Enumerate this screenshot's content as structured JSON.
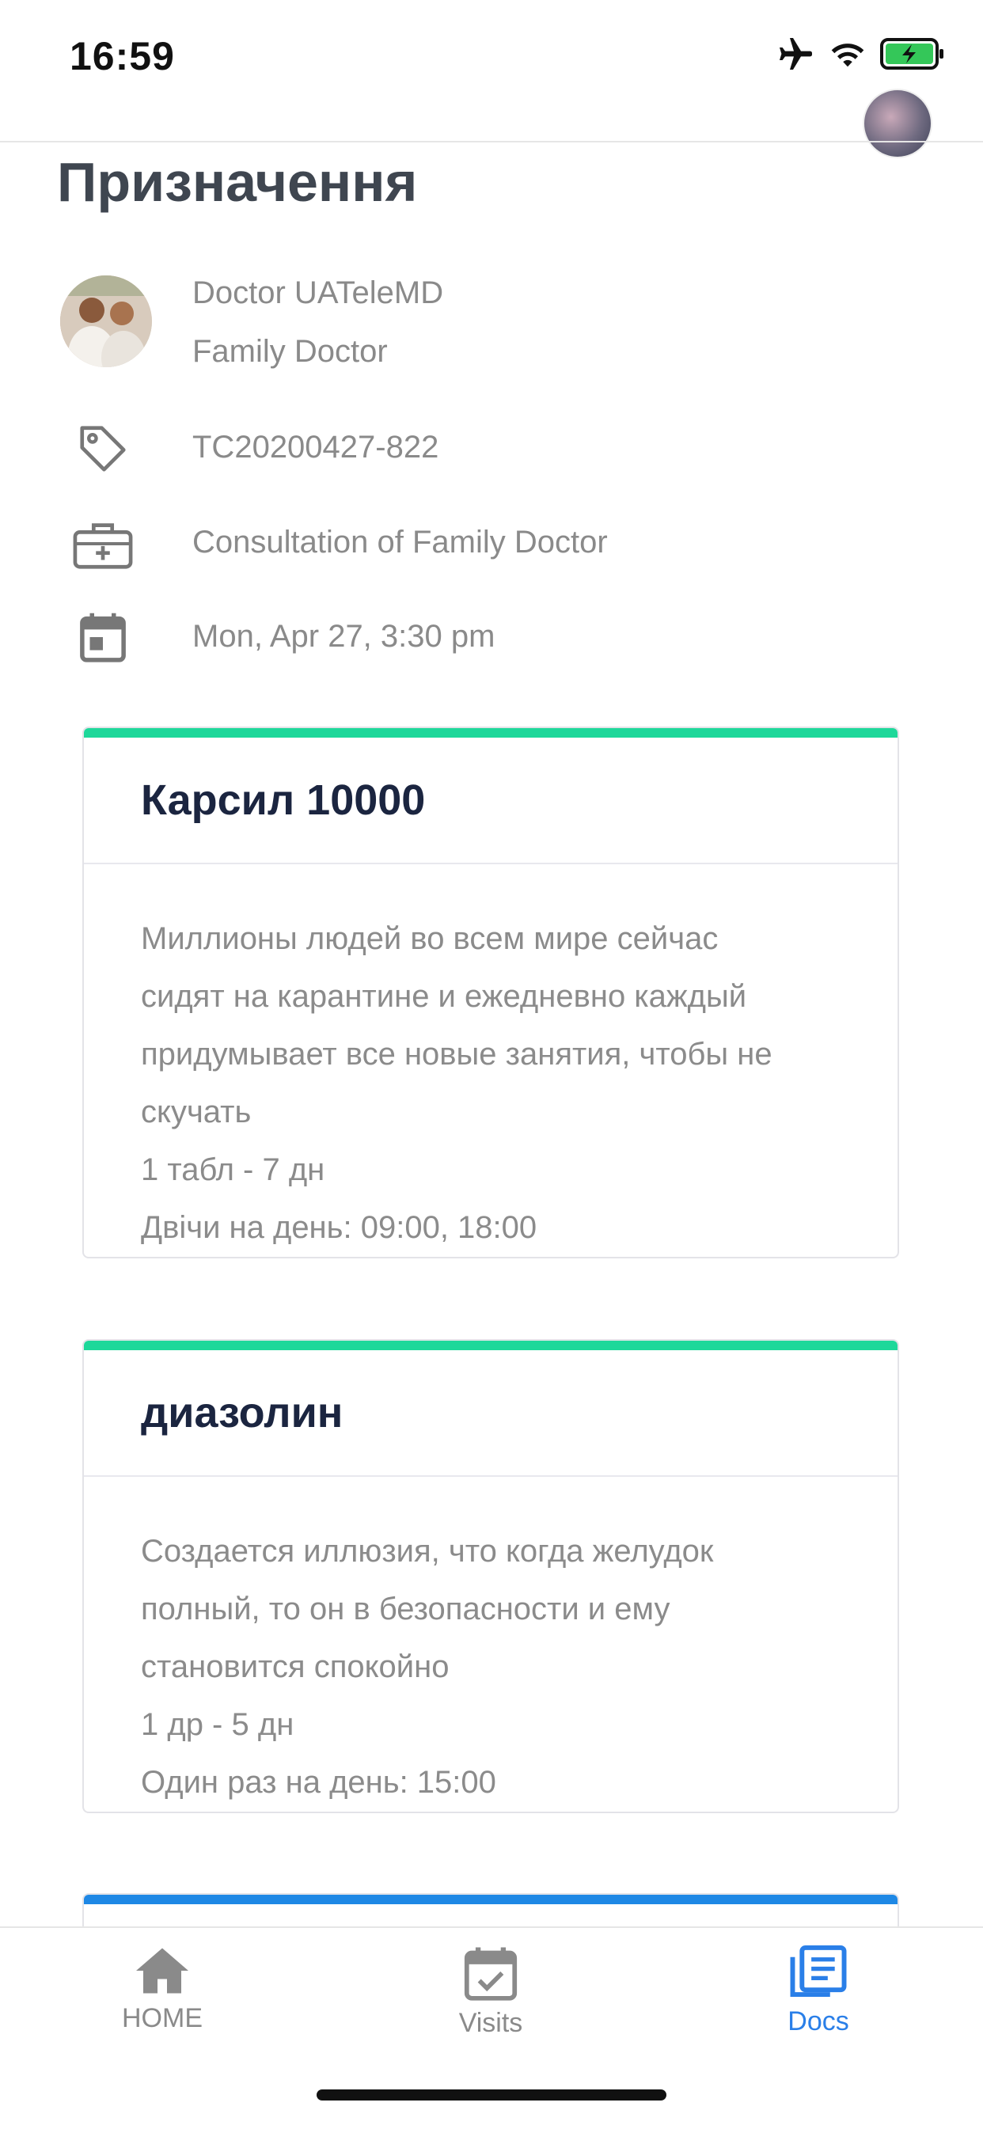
{
  "status_bar": {
    "time": "16:59"
  },
  "header": {
    "title": "Призначення"
  },
  "doctor": {
    "name": "Doctor UATeleMD",
    "role": "Family Doctor"
  },
  "details": {
    "code": "TC20200427-822",
    "service": "Consultation of Family Doctor",
    "datetime": "Mon, Apr 27, 3:30 pm"
  },
  "prescriptions": [
    {
      "title": "Карсил 10000",
      "description_lines": [
        "Миллионы людей во всем мире сейчас",
        "сидят на карантине и ежедневно каждый",
        "придумывает все новые занятия, чтобы не",
        "скучать"
      ],
      "dosage": "1 табл - 7 дн",
      "schedule": "Двічи на день: 09:00, 18:00",
      "accent_color": "#1ed89a"
    },
    {
      "title": "диазолин",
      "description_lines": [
        "Создается иллюзия, что когда желудок",
        "полный, то он в безопасности и ему",
        "становится спокойно"
      ],
      "dosage": "1 др - 5 дн",
      "schedule": "Один раз на день: 15:00",
      "accent_color": "#1ed89a"
    }
  ],
  "tabs": [
    {
      "label": "HOME",
      "icon": "home-icon"
    },
    {
      "label": "Visits",
      "icon": "calendar-check-icon"
    },
    {
      "label": "Docs",
      "icon": "docs-icon",
      "active": true
    }
  ],
  "colors": {
    "accent_green": "#1ed89a",
    "accent_blue": "#2a7fe8",
    "title_dark": "#1b2540"
  }
}
